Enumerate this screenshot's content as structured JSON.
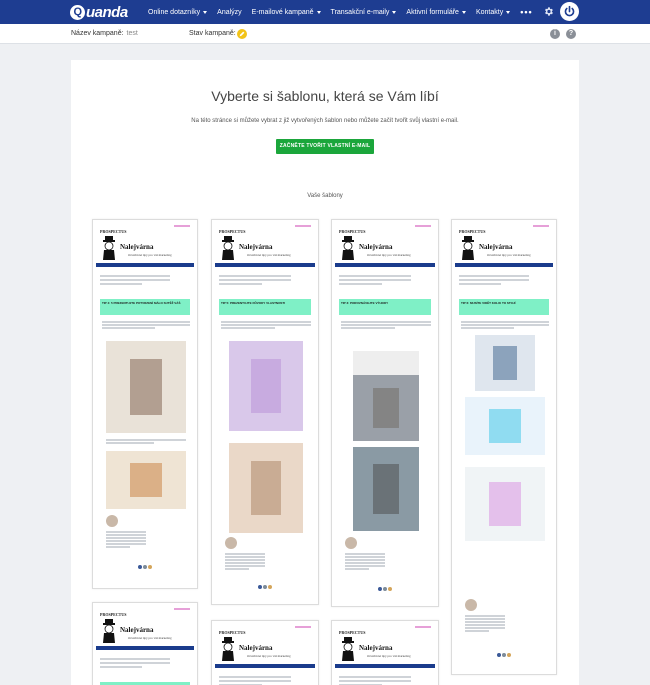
{
  "nav": {
    "logo": "uanda",
    "logo_letter": "Q",
    "items": [
      {
        "label": "Online dotazníky",
        "caret": true
      },
      {
        "label": "Analýzy",
        "caret": false
      },
      {
        "label": "E-mailové kampaně",
        "caret": true
      },
      {
        "label": "Transakční e-maily",
        "caret": true
      },
      {
        "label": "Aktivní formuláře",
        "caret": true
      },
      {
        "label": "Kontakty",
        "caret": true
      }
    ],
    "more": "•••",
    "icons": [
      "gear-icon",
      "power-icon"
    ]
  },
  "campaign": {
    "name_label": "Název kampaně:",
    "name_value": "test",
    "state_label": "Stav kampaně:",
    "info": "i",
    "help": "?"
  },
  "main": {
    "title": "Vyberte si šablonu, která se Vám líbí",
    "subtitle": "Na této stránce si můžete vybrat z již vytvořených šablon nebo můžete začít tvořit svůj vlastní e-mail.",
    "cta_label": "ZAČNĚTE TVOŘIT VLASTNÍ E-MAIL",
    "templates_heading": "Vaše šablony"
  },
  "template_common": {
    "prospect": "PROSPECTUS",
    "hero_name": "Nalejvárna",
    "hero_sub": "Osvědčené tipy pro váš marketing"
  },
  "templates": [
    {
      "tip": "TIP 4: 5 PREZENTUJTE POTVRZENÍ MÁLO SUTĚŽ VÁŠ"
    },
    {
      "tip": "TIP 5: PREZENTUJTE DŮVODY VLASTNOSTI"
    },
    {
      "tip": "TIP 3: POROVNÁVEJTE VÝHODY"
    },
    {
      "tip": "TIP 6: MUSÍTE VIDĚT KOLIK TO STOJÍ"
    },
    {
      "tip": "TIP 2: ZOBRAZTE KOMUNIKACI"
    },
    {
      "tip": ""
    },
    {
      "tip": ""
    }
  ],
  "colors": {
    "nav_bg": "#1e3d91",
    "cta_bg": "#1ba63b",
    "mint": "#7ff0c6",
    "state_yellow": "#f2c318"
  }
}
